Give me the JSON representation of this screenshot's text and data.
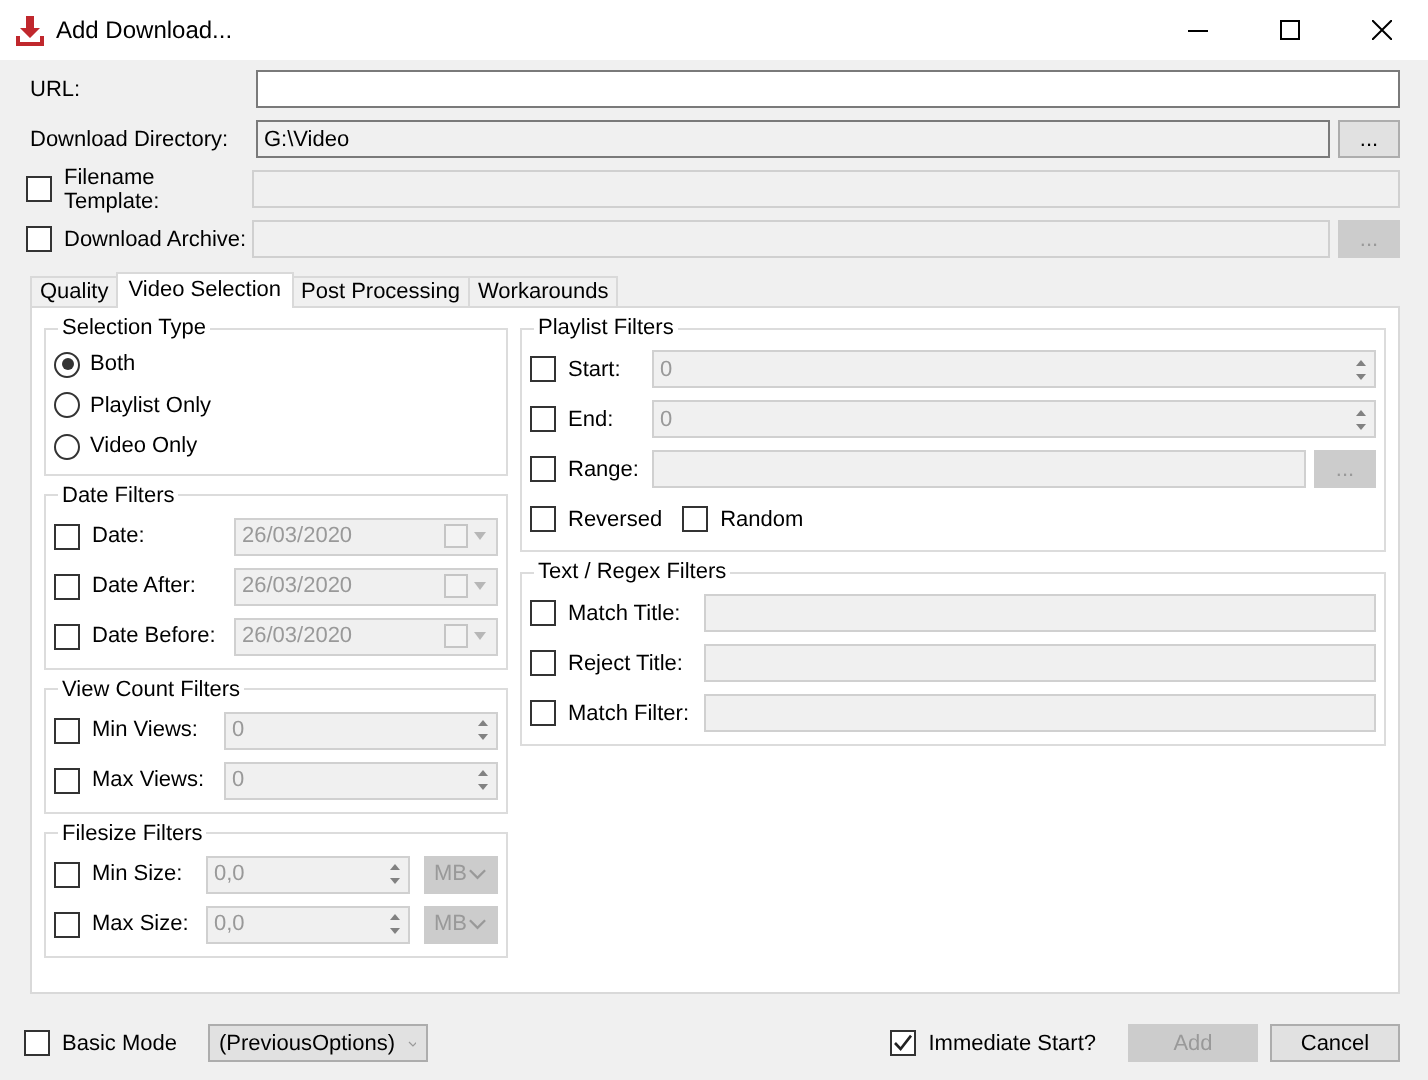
{
  "window": {
    "title": "Add Download..."
  },
  "url": {
    "label": "URL:"
  },
  "directory": {
    "label": "Download Directory:",
    "value": "G:\\Video",
    "button": "..."
  },
  "filename_template": {
    "label": "Filename Template:",
    "checked": false
  },
  "download_archive": {
    "label": "Download Archive:",
    "checked": false,
    "button": "..."
  },
  "tabs": [
    {
      "label": "Quality",
      "selected": false
    },
    {
      "label": "Video Selection",
      "selected": true
    },
    {
      "label": "Post Processing",
      "selected": false
    },
    {
      "label": "Workarounds",
      "selected": false
    }
  ],
  "left_groups": [
    {
      "title": "Selection Type",
      "rows": [
        {
          "kind": "radio",
          "label": "Both",
          "selected": true
        },
        {
          "kind": "radio",
          "label": "Playlist Only",
          "selected": false
        },
        {
          "kind": "radio",
          "label": "Video Only",
          "selected": false
        }
      ]
    },
    {
      "title": "Date Filters",
      "rows": [
        {
          "kind": "date",
          "label": "Date:",
          "checked": false,
          "value": "26/03/2020"
        },
        {
          "kind": "date",
          "label": "Date After:",
          "checked": false,
          "value": "26/03/2020"
        },
        {
          "kind": "date",
          "label": "Date Before:",
          "checked": false,
          "value": "26/03/2020"
        }
      ]
    },
    {
      "title": "View Count Filters",
      "rows": [
        {
          "kind": "spin",
          "label": "Min Views:",
          "checked": false,
          "value": "0"
        },
        {
          "kind": "spin",
          "label": "Max Views:",
          "checked": false,
          "value": "0"
        }
      ]
    },
    {
      "title": "Filesize Filters",
      "rows": [
        {
          "kind": "size",
          "label": "Min Size:",
          "checked": false,
          "value": "0,0",
          "unit": "MB"
        },
        {
          "kind": "size",
          "label": "Max Size:",
          "checked": false,
          "value": "0,0",
          "unit": "MB"
        }
      ]
    }
  ],
  "right_groups": [
    {
      "title": "Playlist Filters",
      "rows": [
        {
          "kind": "spin",
          "label": "Start:",
          "checked": false,
          "value": "0"
        },
        {
          "kind": "spin",
          "label": "End:",
          "checked": false,
          "value": "0"
        },
        {
          "kind": "browse",
          "label": "Range:",
          "checked": false,
          "button": "..."
        },
        {
          "kind": "checks",
          "items": [
            {
              "label": "Reversed",
              "checked": false
            },
            {
              "label": "Random",
              "checked": false
            }
          ]
        }
      ]
    },
    {
      "title": "Text / Regex Filters",
      "rows": [
        {
          "kind": "text",
          "label": "Match Title:",
          "checked": false
        },
        {
          "kind": "text",
          "label": "Reject Title:",
          "checked": false
        },
        {
          "kind": "text",
          "label": "Match Filter:",
          "checked": false
        }
      ]
    }
  ],
  "footer": {
    "basic_mode": {
      "label": "Basic Mode",
      "checked": false
    },
    "profile": "(PreviousOptions)",
    "immediate_start": {
      "label": "Immediate Start?",
      "checked": true
    },
    "buttons": [
      {
        "label": "Add",
        "disabled": true
      },
      {
        "label": "Cancel",
        "disabled": false
      }
    ]
  }
}
